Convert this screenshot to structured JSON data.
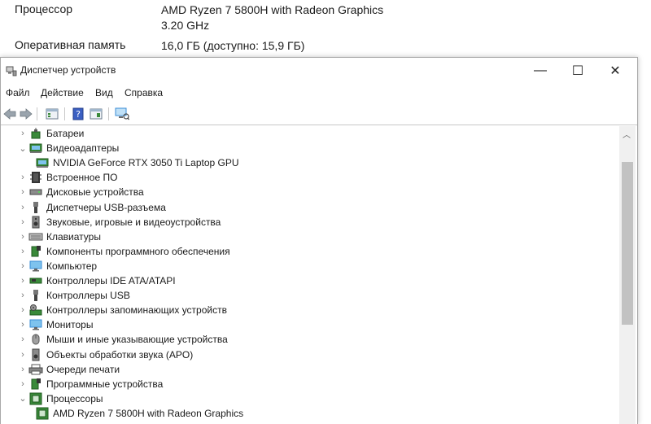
{
  "system_info": {
    "processor_label": "Процессор",
    "processor_value_line1": "AMD Ryzen 7 5800H with Radeon Graphics",
    "processor_value_line2": "3.20 GHz",
    "ram_label": "Оперативная память",
    "ram_value": "16,0 ГБ (доступно: 15,9 ГБ)"
  },
  "window": {
    "title": "Диспетчер устройств",
    "icon": "device-manager-icon",
    "controls": {
      "minimize": "—",
      "maximize": "☐",
      "close": "✕"
    }
  },
  "menu": [
    "Файл",
    "Действие",
    "Вид",
    "Справка"
  ],
  "toolbar": [
    "back-arrow-icon",
    "forward-arrow-icon",
    "properties-icon",
    "help-icon",
    "view-icon",
    "scan-hardware-icon"
  ],
  "tree": [
    {
      "label": "Батареи",
      "expanded": false,
      "level": 0,
      "icon": "battery-icon"
    },
    {
      "label": "Видеоадаптеры",
      "expanded": true,
      "level": 0,
      "icon": "display-adapter-icon"
    },
    {
      "label": "NVIDIA GeForce RTX 3050 Ti Laptop GPU",
      "level": 1,
      "icon": "display-adapter-icon"
    },
    {
      "label": "Встроенное ПО",
      "expanded": false,
      "level": 0,
      "icon": "firmware-icon"
    },
    {
      "label": "Дисковые устройства",
      "expanded": false,
      "level": 0,
      "icon": "disk-drive-icon"
    },
    {
      "label": "Диспетчеры USB-разъема",
      "expanded": false,
      "level": 0,
      "icon": "usb-connector-icon"
    },
    {
      "label": "Звуковые, игровые и видеоустройства",
      "expanded": false,
      "level": 0,
      "icon": "speaker-icon"
    },
    {
      "label": "Клавиатуры",
      "expanded": false,
      "level": 0,
      "icon": "keyboard-icon"
    },
    {
      "label": "Компоненты программного обеспечения",
      "expanded": false,
      "level": 0,
      "icon": "software-component-icon"
    },
    {
      "label": "Компьютер",
      "expanded": false,
      "level": 0,
      "icon": "computer-icon"
    },
    {
      "label": "Контроллеры IDE ATA/ATAPI",
      "expanded": false,
      "level": 0,
      "icon": "ide-controller-icon"
    },
    {
      "label": "Контроллеры USB",
      "expanded": false,
      "level": 0,
      "icon": "usb-controller-icon"
    },
    {
      "label": "Контроллеры запоминающих устройств",
      "expanded": false,
      "level": 0,
      "icon": "storage-controller-icon"
    },
    {
      "label": "Мониторы",
      "expanded": false,
      "level": 0,
      "icon": "monitor-icon"
    },
    {
      "label": "Мыши и иные указывающие устройства",
      "expanded": false,
      "level": 0,
      "icon": "mouse-icon"
    },
    {
      "label": "Объекты обработки звука (APO)",
      "expanded": false,
      "level": 0,
      "icon": "audio-processing-icon"
    },
    {
      "label": "Очереди печати",
      "expanded": false,
      "level": 0,
      "icon": "printer-icon"
    },
    {
      "label": "Программные устройства",
      "expanded": false,
      "level": 0,
      "icon": "software-device-icon"
    },
    {
      "label": "Процессоры",
      "expanded": true,
      "level": 0,
      "icon": "processor-icon"
    },
    {
      "label": "AMD Ryzen 7 5800H with Radeon Graphics",
      "level": 1,
      "icon": "processor-icon"
    }
  ],
  "colors": {
    "folder_green": "#3a8a3a",
    "monitor_blue": "#3b8ed6",
    "chip_dark": "#333333",
    "scroll_thumb": "#c2c2c2"
  }
}
